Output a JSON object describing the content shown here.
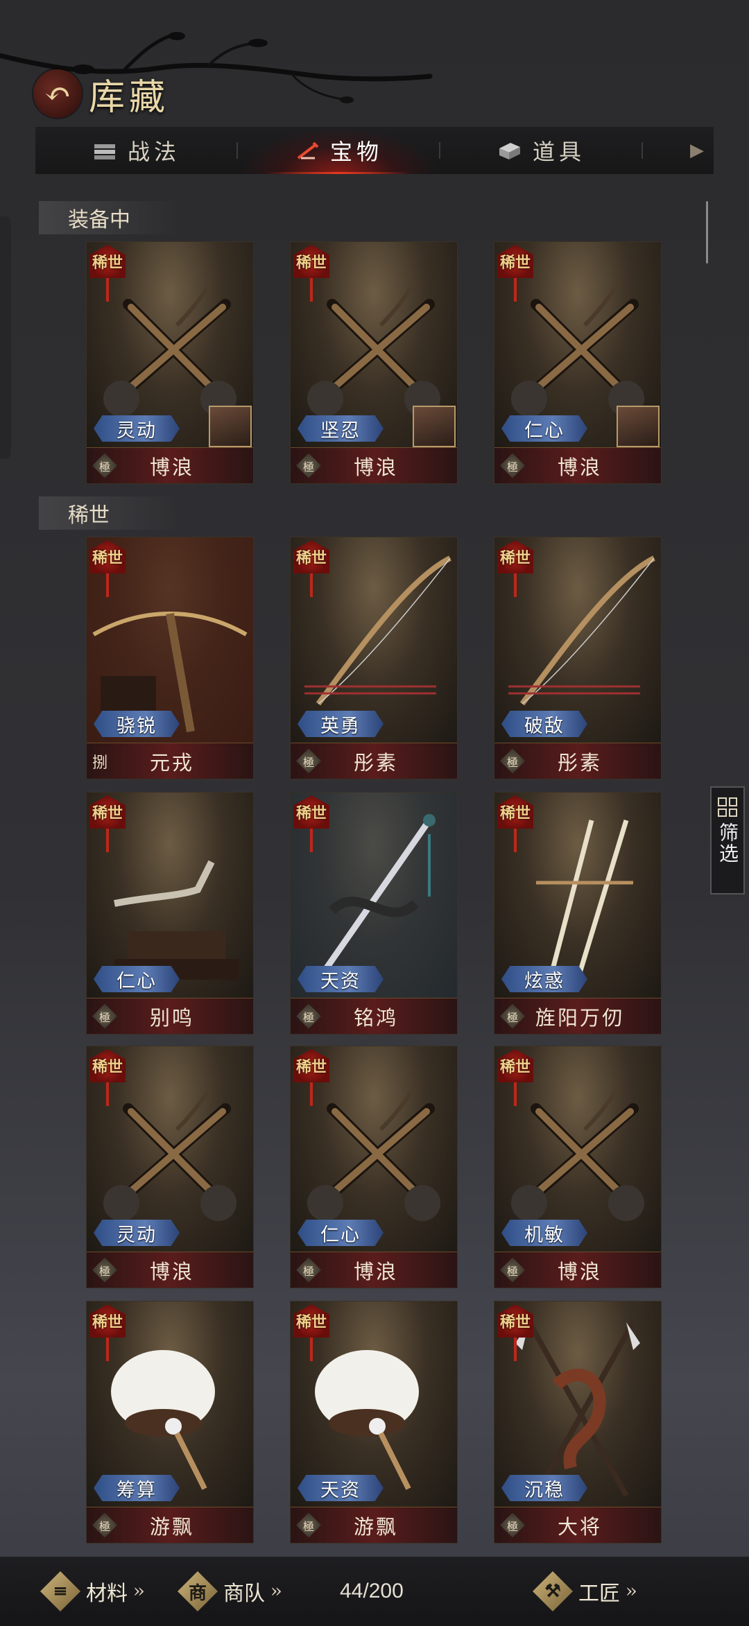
{
  "header": {
    "title": "库藏",
    "back_icon": "back-arrow-icon"
  },
  "tabs": [
    {
      "label": "战法",
      "icon": "scroll-bundle-icon",
      "active": false
    },
    {
      "label": "宝物",
      "icon": "treasure-icon",
      "active": true
    },
    {
      "label": "道具",
      "icon": "chest-icon",
      "active": false
    }
  ],
  "sections": [
    {
      "title": "装备中",
      "items": [
        {
          "tag": "稀世",
          "trait": "灵动",
          "level": "極",
          "name": "博浪",
          "art": "mace",
          "portrait": true
        },
        {
          "tag": "稀世",
          "trait": "坚忍",
          "level": "極",
          "name": "博浪",
          "art": "mace",
          "portrait": true
        },
        {
          "tag": "稀世",
          "trait": "仁心",
          "level": "極",
          "name": "博浪",
          "art": "mace",
          "portrait": true
        }
      ]
    },
    {
      "title": "稀世",
      "items": [
        {
          "tag": "稀世",
          "trait": "骁锐",
          "level": "捌",
          "name": "元戎",
          "art": "crossbow",
          "portrait": false
        },
        {
          "tag": "稀世",
          "trait": "英勇",
          "level": "極",
          "name": "彤素",
          "art": "bow",
          "portrait": false
        },
        {
          "tag": "稀世",
          "trait": "破敌",
          "level": "極",
          "name": "彤素",
          "art": "bow",
          "portrait": false
        },
        {
          "tag": "稀世",
          "trait": "仁心",
          "level": "極",
          "name": "别鸣",
          "art": "blade",
          "portrait": false
        },
        {
          "tag": "稀世",
          "trait": "天资",
          "level": "極",
          "name": "铭鸿",
          "art": "sword",
          "portrait": false
        },
        {
          "tag": "稀世",
          "trait": "炫惑",
          "level": "極",
          "name": "旌阳万仞",
          "art": "twin-swords",
          "portrait": false
        },
        {
          "tag": "稀世",
          "trait": "灵动",
          "level": "極",
          "name": "博浪",
          "art": "mace",
          "portrait": false
        },
        {
          "tag": "稀世",
          "trait": "仁心",
          "level": "極",
          "name": "博浪",
          "art": "mace",
          "portrait": false
        },
        {
          "tag": "稀世",
          "trait": "机敏",
          "level": "極",
          "name": "博浪",
          "art": "mace",
          "portrait": false
        },
        {
          "tag": "稀世",
          "trait": "筹算",
          "level": "極",
          "name": "游飘",
          "art": "fan",
          "portrait": false
        },
        {
          "tag": "稀世",
          "trait": "天资",
          "level": "極",
          "name": "游飘",
          "art": "fan",
          "portrait": false
        },
        {
          "tag": "稀世",
          "trait": "沉稳",
          "level": "極",
          "name": "大将",
          "art": "halberds",
          "portrait": false
        }
      ]
    }
  ],
  "filter": {
    "label": "筛选"
  },
  "bottom_bar": {
    "materials": {
      "label": "材料",
      "icon_glyph": ""
    },
    "caravan": {
      "label": "商队",
      "icon_glyph": "商"
    },
    "count": "44/200",
    "craftsman": {
      "label": "工匠",
      "icon_glyph": ""
    }
  }
}
